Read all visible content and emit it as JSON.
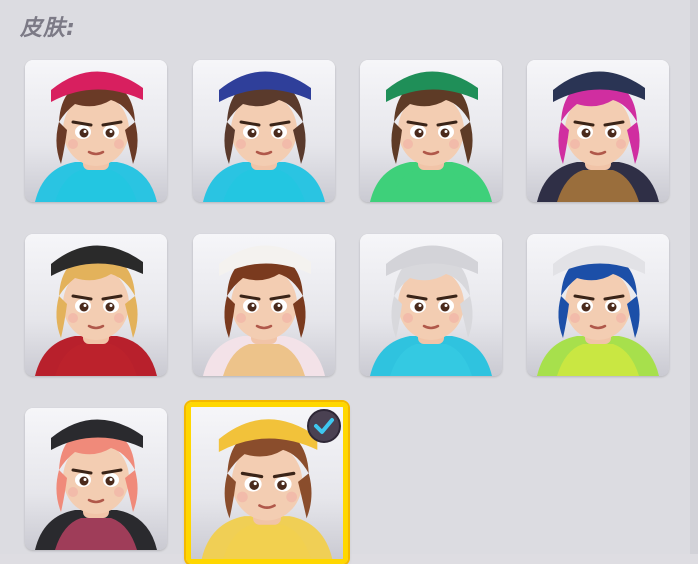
{
  "section": {
    "title": "皮肤:"
  },
  "skins": [
    {
      "name": "skin-1",
      "hair": "#6a3a26",
      "hat": "#d81f5f",
      "accent": "#1ec8e0",
      "outfit": "#2ac4e2",
      "selected": false
    },
    {
      "name": "skin-2",
      "hair": "#5a3a2c",
      "hat": "#2f3f9a",
      "accent": "#1ec8e0",
      "outfit": "#2ac4e2",
      "selected": false
    },
    {
      "name": "skin-3",
      "hair": "#5e3b26",
      "hat": "#1f8f58",
      "accent": "#3ed07a",
      "outfit": "#3ed07a",
      "selected": false
    },
    {
      "name": "skin-4",
      "hair": "#d02ea0",
      "hat": "#2a3454",
      "accent": "#f2a235",
      "outfit": "#2f2f46",
      "selected": false
    },
    {
      "name": "skin-5",
      "hair": "#e3b25b",
      "hat": "#2a2a2a",
      "accent": "#c0242e",
      "outfit": "#b8202c",
      "selected": false
    },
    {
      "name": "skin-6",
      "hair": "#7a3a1e",
      "hat": "#f4f2ef",
      "accent": "#e8a93c",
      "outfit": "#f3e2e8",
      "selected": false
    },
    {
      "name": "skin-7",
      "hair": "#d8d8dc",
      "hat": "#d3d3d8",
      "accent": "#38cde4",
      "outfit": "#2fc3df",
      "selected": false
    },
    {
      "name": "skin-8",
      "hair": "#1c4fa8",
      "hat": "#e2e2e6",
      "accent": "#e6ec3a",
      "outfit": "#a7e04c",
      "selected": false
    },
    {
      "name": "skin-9",
      "hair": "#f08a7a",
      "hat": "#2a2a2e",
      "accent": "#ff4d7d",
      "outfit": "#2a2a2e",
      "selected": false
    },
    {
      "name": "skin-10",
      "hair": "#8a4d2c",
      "hat": "#f2c23a",
      "accent": "#f4d24a",
      "outfit": "#f0cf55",
      "selected": true
    }
  ]
}
